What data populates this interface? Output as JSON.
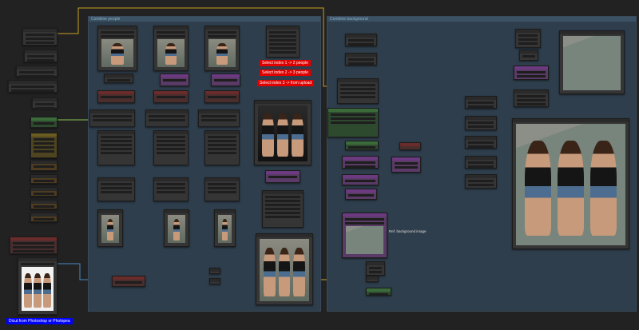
{
  "groups": [
    {
      "title": "Combine people"
    },
    {
      "title": "Combine background"
    }
  ],
  "labels": {
    "select_2": "Select index 1 -> 2 people",
    "select_3": "Select index 2 -> 3 people",
    "select_upload": "Select index 3 -> from upload",
    "ref_background": "Ref. background image",
    "dicut": "Dicut from Photoshop or Photopea"
  },
  "colors": {
    "canvas": "#222222",
    "group": "#2f3e4c",
    "wire_blue": "#4a8ac0",
    "wire_yellow": "#c8a020",
    "label_red": "#e00000",
    "label_blue": "#0000ff"
  }
}
